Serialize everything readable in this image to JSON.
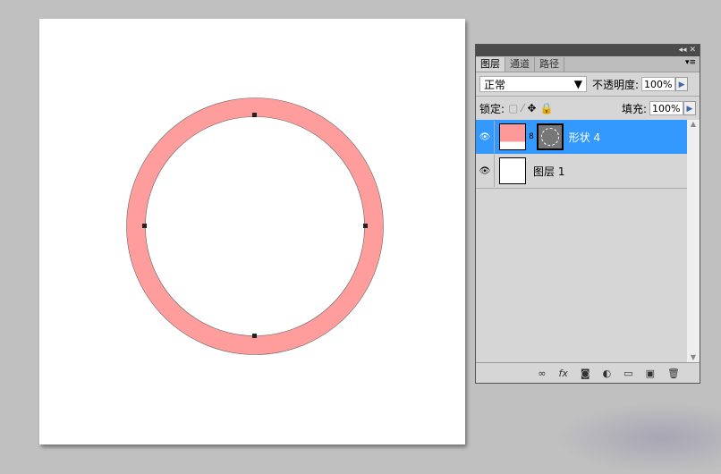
{
  "panel": {
    "tabs": [
      "图层",
      "通道",
      "路径"
    ],
    "blend_mode": "正常",
    "opacity_label": "不透明度:",
    "opacity": "100%",
    "lock_label": "锁定:",
    "fill_label": "填充:",
    "fill": "100%"
  },
  "layers": [
    {
      "name": "形状 4",
      "selected": true,
      "color": "#ff9999"
    },
    {
      "name": "图层 1",
      "selected": false
    }
  ],
  "shape": {
    "fill": "#ff9c9c"
  }
}
